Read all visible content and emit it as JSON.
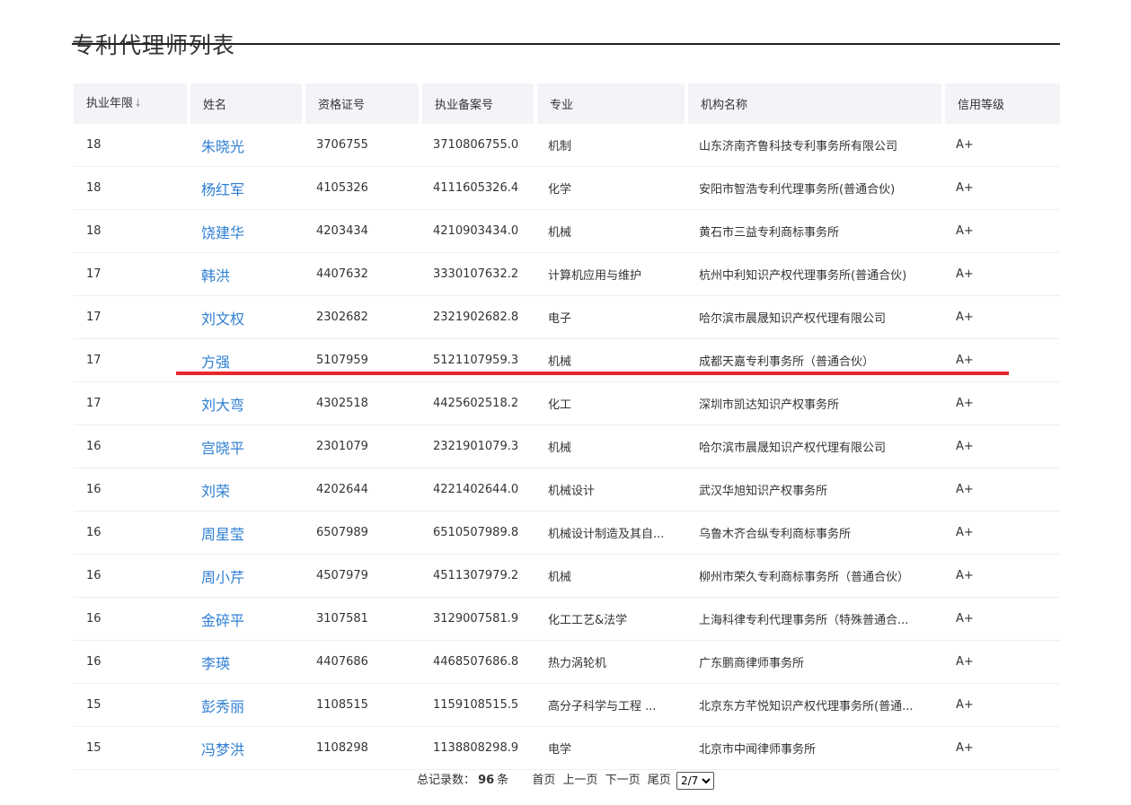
{
  "page": {
    "title": "专利代理师列表"
  },
  "table": {
    "headers": {
      "years": "执业年限",
      "name": "姓名",
      "cert_no": "资格证号",
      "record_no": "执业备案号",
      "major": "专业",
      "org": "机构名称",
      "credit": "信用等级"
    },
    "sort_icon": "arrow-down-icon",
    "rows": [
      {
        "years": "18",
        "name": "朱晓光",
        "cert_no": "3706755",
        "record_no": "3710806755.0",
        "major": "机制",
        "org": "山东济南齐鲁科技专利事务所有限公司",
        "credit": "A+"
      },
      {
        "years": "18",
        "name": "杨红军",
        "cert_no": "4105326",
        "record_no": "4111605326.4",
        "major": "化学",
        "org": "安阳市智浩专利代理事务所(普通合伙)",
        "credit": "A+"
      },
      {
        "years": "18",
        "name": "饶建华",
        "cert_no": "4203434",
        "record_no": "4210903434.0",
        "major": "机械",
        "org": "黄石市三益专利商标事务所",
        "credit": "A+"
      },
      {
        "years": "17",
        "name": "韩洪",
        "cert_no": "4407632",
        "record_no": "3330107632.2",
        "major": "计算机应用与维护",
        "org": "杭州中利知识产权代理事务所(普通合伙)",
        "credit": "A+"
      },
      {
        "years": "17",
        "name": "刘文权",
        "cert_no": "2302682",
        "record_no": "2321902682.8",
        "major": "电子",
        "org": "哈尔滨市晨晟知识产权代理有限公司",
        "credit": "A+"
      },
      {
        "years": "17",
        "name": "方强",
        "cert_no": "5107959",
        "record_no": "5121107959.3",
        "major": "机械",
        "org": "成都天嘉专利事务所（普通合伙）",
        "credit": "A+"
      },
      {
        "years": "17",
        "name": "刘大弯",
        "cert_no": "4302518",
        "record_no": "4425602518.2",
        "major": "化工",
        "org": "深圳市凯达知识产权事务所",
        "credit": "A+"
      },
      {
        "years": "16",
        "name": "宫晓平",
        "cert_no": "2301079",
        "record_no": "2321901079.3",
        "major": "机械",
        "org": "哈尔滨市晨晟知识产权代理有限公司",
        "credit": "A+"
      },
      {
        "years": "16",
        "name": "刘荣",
        "cert_no": "4202644",
        "record_no": "4221402644.0",
        "major": "机械设计",
        "org": "武汉华旭知识产权事务所",
        "credit": "A+"
      },
      {
        "years": "16",
        "name": "周星莹",
        "cert_no": "6507989",
        "record_no": "6510507989.8",
        "major": "机械设计制造及其自...",
        "org": "乌鲁木齐合纵专利商标事务所",
        "credit": "A+"
      },
      {
        "years": "16",
        "name": "周小芹",
        "cert_no": "4507979",
        "record_no": "4511307979.2",
        "major": "机械",
        "org": "柳州市荣久专利商标事务所（普通合伙）",
        "credit": "A+"
      },
      {
        "years": "16",
        "name": "金碎平",
        "cert_no": "3107581",
        "record_no": "3129007581.9",
        "major": "化工工艺&法学",
        "org": "上海科律专利代理事务所（特殊普通合...",
        "credit": "A+"
      },
      {
        "years": "16",
        "name": "李瑛",
        "cert_no": "4407686",
        "record_no": "4468507686.8",
        "major": "热力涡轮机",
        "org": "广东鹏商律师事务所",
        "credit": "A+"
      },
      {
        "years": "15",
        "name": "彭秀丽",
        "cert_no": "1108515",
        "record_no": "1159108515.5",
        "major": "高分子科学与工程 ...",
        "org": "北京东方芊悦知识产权代理事务所(普通...",
        "credit": "A+"
      },
      {
        "years": "15",
        "name": "冯梦洪",
        "cert_no": "1108298",
        "record_no": "1138808298.9",
        "major": "电学",
        "org": "北京市中闻律师事务所",
        "credit": "A+"
      }
    ]
  },
  "pager": {
    "total_label": "总记录数：",
    "total_count": "96",
    "total_unit": "条",
    "first": "首页",
    "prev": "上一页",
    "next": "下一页",
    "last": "尾页",
    "page_select": "2/7"
  },
  "colors": {
    "link": "#2f7fd3",
    "highlight_line": "#e8262b",
    "header_bg": "#f2f4f8"
  }
}
